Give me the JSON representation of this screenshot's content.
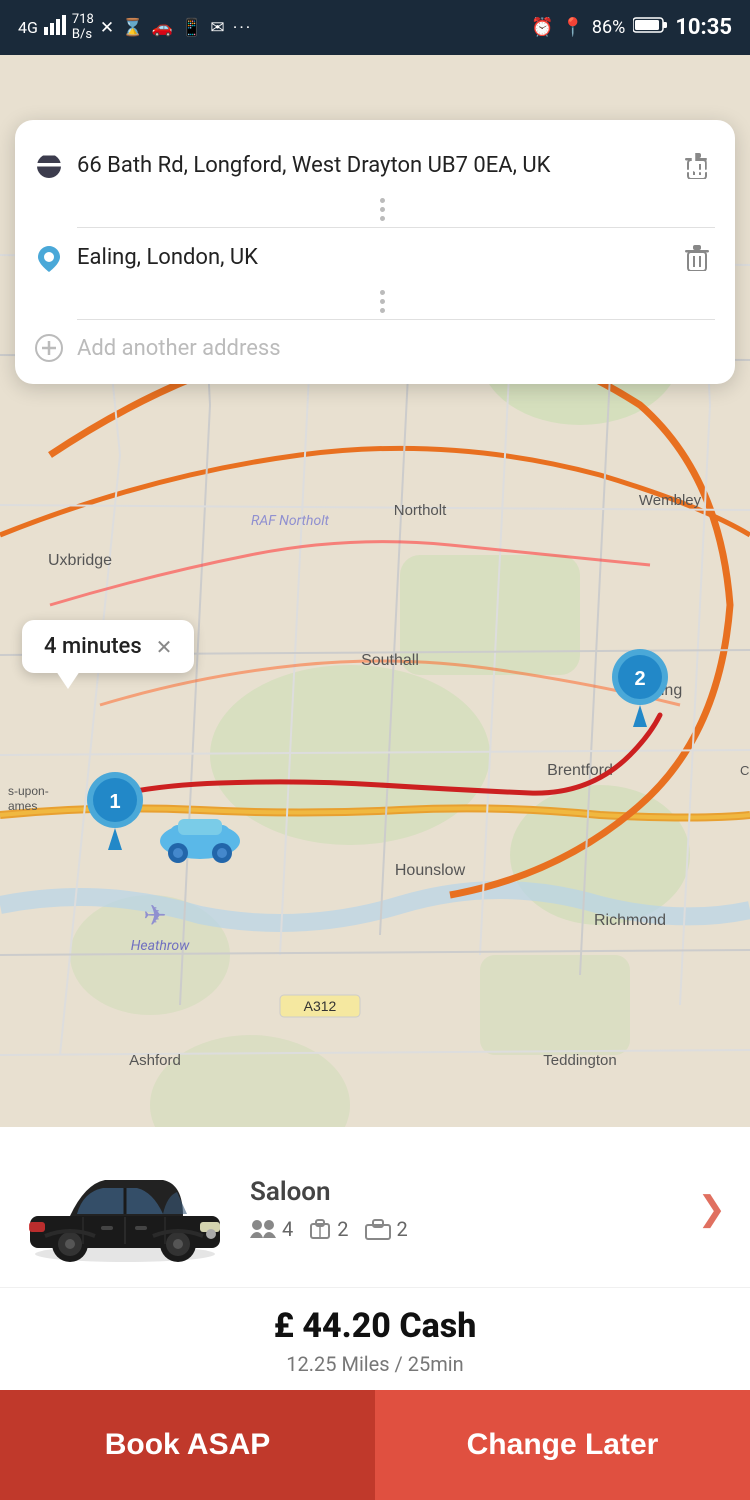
{
  "statusBar": {
    "leftText": "4G  718 B/s",
    "battery": "86%",
    "time": "10:35",
    "icons": [
      "signal",
      "data-rate",
      "missed-call",
      "timer",
      "car",
      "whatsapp",
      "mail",
      "dots",
      "alarm",
      "location",
      "battery"
    ]
  },
  "addressCard": {
    "origin": {
      "text": "66 Bath Rd, Longford, West Drayton UB7 0EA, UK"
    },
    "destination": {
      "text": "Ealing, London, UK"
    },
    "addPlaceholder": "Add another address"
  },
  "map": {
    "timeBubble": "4 minutes",
    "places": [
      "Uxbridge",
      "RAF Northolt",
      "Northolt",
      "Wembley",
      "Southall",
      "Brentford",
      "Ealing",
      "Hounslow",
      "Richmond",
      "Heathrow",
      "Ashford",
      "Teddington",
      "A312",
      "Chi..."
    ]
  },
  "bottomPanel": {
    "carType": "Saloon",
    "passengers": "4",
    "luggage1": "2",
    "luggage2": "2",
    "price": "£ 44.20 Cash",
    "tripDetails": "12.25 Miles / 25min",
    "bookAsap": "Book ASAP",
    "changeLater": "Change Later"
  }
}
